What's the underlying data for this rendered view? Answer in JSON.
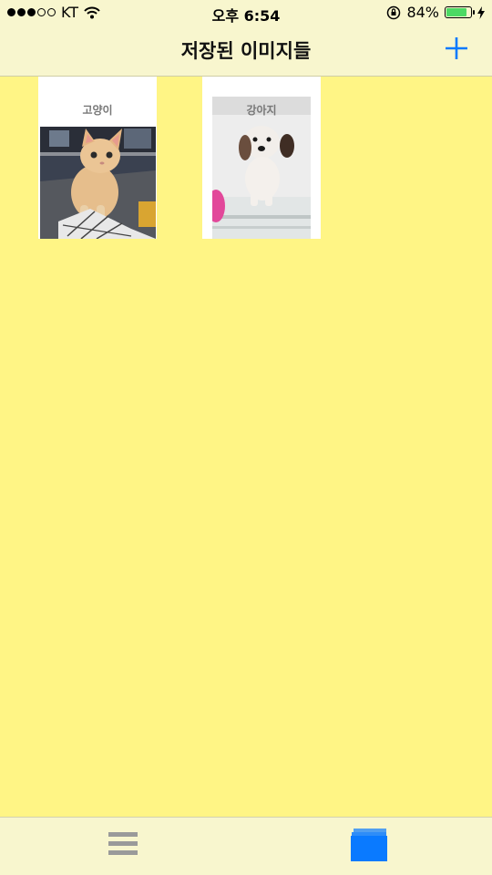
{
  "status_bar": {
    "carrier": "KT",
    "time": "오후 6:54",
    "battery_percent": "84%",
    "signal_bars_filled": 3,
    "signal_bars_total": 5,
    "battery_level": 0.84
  },
  "nav": {
    "title": "저장된 이미지들",
    "add_icon": "plus-icon"
  },
  "images": [
    {
      "label": "고양이",
      "subject": "kitten"
    },
    {
      "label": "강아지",
      "subject": "puppy"
    }
  ],
  "tab_bar": {
    "tabs": [
      {
        "icon": "list-icon",
        "selected": false
      },
      {
        "icon": "stack-icon",
        "selected": true
      }
    ]
  },
  "colors": {
    "background": "#FFF585",
    "bars": "#F8F6CE",
    "accent": "#0A7AFF",
    "tab_inactive": "#9A9A9A"
  }
}
